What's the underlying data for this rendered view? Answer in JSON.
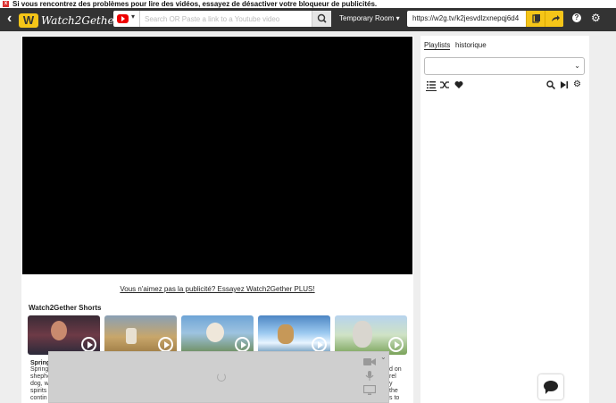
{
  "alert": {
    "text": "Si vous rencontrez des problèmes pour lire des vidéos, essayez de désactiver votre bloqueur de publicités."
  },
  "header": {
    "logo_text": "Watch2Gether",
    "search_placeholder": "Search OR Paste a link to a Youtube video",
    "room_label": "Temporary Room ▾",
    "room_url": "https://w2g.tv/k2jesvdlzxnepqj6d4"
  },
  "main": {
    "ad_text": "Vous n'aimez pas la publicité? Essayez Watch2Gether PLUS!",
    "shorts_title": "Watch2Gether Shorts",
    "first_card_title": "Spring",
    "first_card_desc": [
      "Spring",
      "shephe",
      "dog, w",
      "spirits i",
      "contin"
    ],
    "last_card_desc": [
      "d on",
      "rel",
      "y",
      "the",
      "s to"
    ]
  },
  "sidebar": {
    "tabs": [
      "Playlists",
      "historique"
    ],
    "select_value": ""
  },
  "colors": {
    "accent": "#f5c518",
    "topbar": "#333333"
  }
}
